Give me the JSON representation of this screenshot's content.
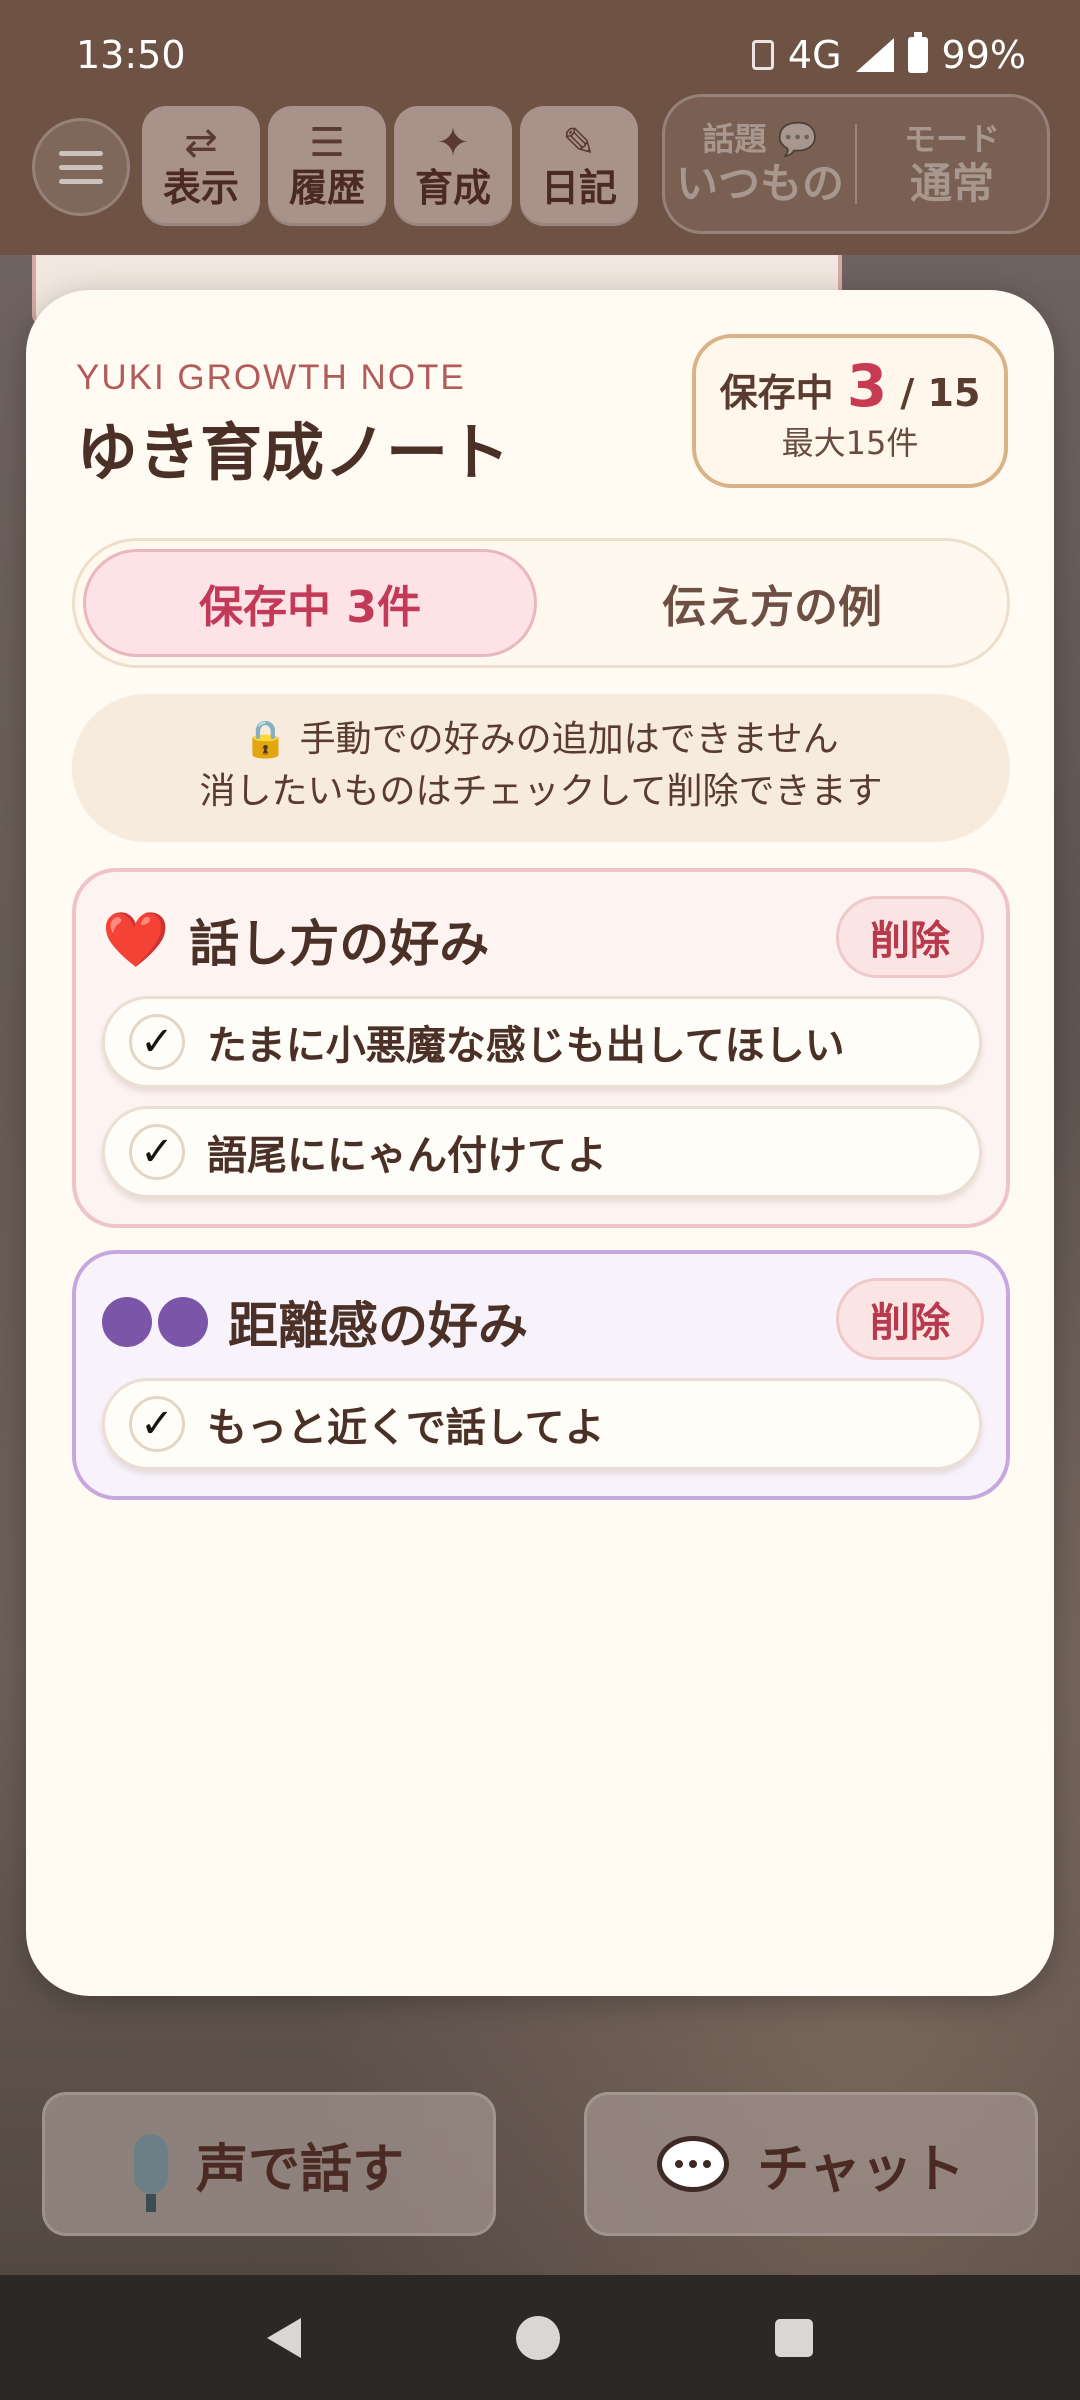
{
  "status": {
    "time": "13:50",
    "network": "4G",
    "battery": "99%"
  },
  "toolbar": {
    "buttons": [
      {
        "icon": "⇄",
        "label": "表示"
      },
      {
        "icon": "☰",
        "label": "履歴"
      },
      {
        "icon": "✦",
        "label": "育成"
      },
      {
        "icon": "✎",
        "label": "日記"
      }
    ],
    "topic_key": "話題 💬",
    "topic_value": "いつもの",
    "mode_key": "モード",
    "mode_value": "通常"
  },
  "sheet": {
    "eyebrow": "YUKI GROWTH NOTE",
    "title": "ゆき育成ノート",
    "counter_prefix": "保存中",
    "counter_count": "3",
    "counter_total": "/ 15",
    "counter_max": "最大15件",
    "tabs": [
      "保存中 3件",
      "伝え方の例"
    ],
    "notice_line1": "🔒 手動での好みの追加はできません",
    "notice_line2": "消したいものはチェックして削除できます",
    "delete_label": "削除",
    "check_mark": "✓",
    "categories": [
      {
        "icon": "❤️",
        "title": "話し方の好み",
        "items": [
          "たまに小悪魔な感じも出してほしい",
          "語尾ににゃん付けてよ"
        ]
      },
      {
        "icon": "●●",
        "title": "距離感の好み",
        "items": [
          "もっと近くで話してよ"
        ]
      }
    ]
  },
  "actions": {
    "voice": "声で話す",
    "chat": "チャット"
  }
}
